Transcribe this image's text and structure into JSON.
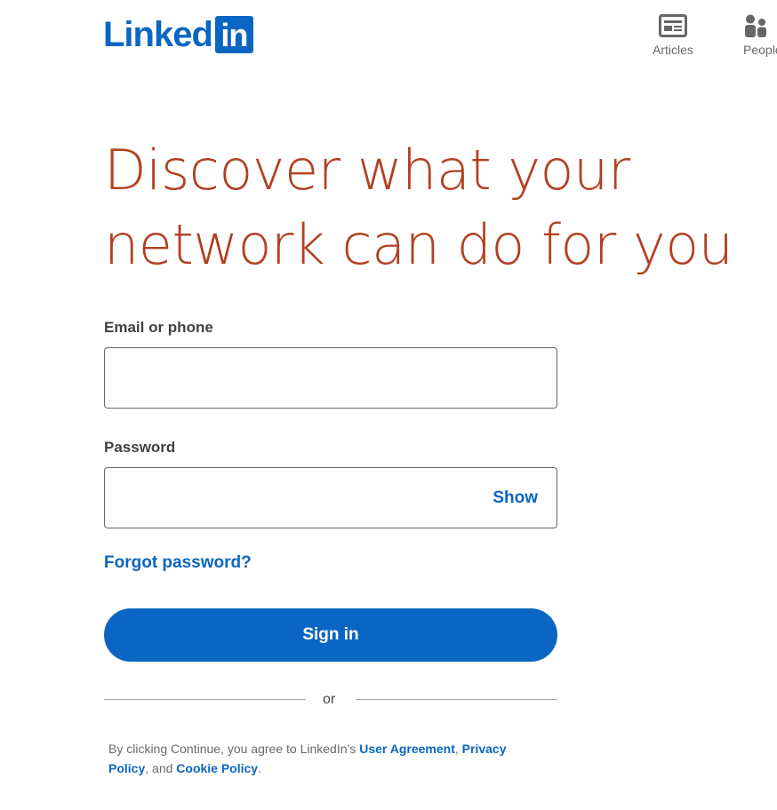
{
  "brand": {
    "logo_word": "Linked",
    "logo_box": "in",
    "color": "#0a66c2"
  },
  "nav": {
    "articles": {
      "label": "Articles",
      "icon": "newspaper-icon"
    },
    "people": {
      "label": "People",
      "icon": "people-icon"
    }
  },
  "hero": {
    "line1": "Discover what your",
    "line2": "network can do for you",
    "color": "#b24020"
  },
  "form": {
    "email_label": "Email or phone",
    "email_value": "",
    "password_label": "Password",
    "password_value": "",
    "show_label": "Show",
    "forgot_label": "Forgot password?",
    "signin_label": "Sign in",
    "divider_text": "or"
  },
  "legal": {
    "prefix": "By clicking Continue, you agree to LinkedIn’s ",
    "user_agreement": "User Agreement",
    "sep1": ", ",
    "privacy_policy": "Privacy Policy",
    "sep2": ", and ",
    "cookie_policy": "Cookie Policy",
    "suffix": "."
  }
}
